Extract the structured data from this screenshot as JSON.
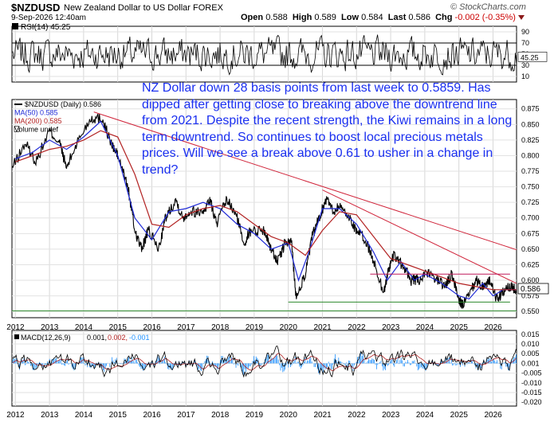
{
  "header": {
    "symbol": "$NZDUSD",
    "name": "New Zealand Dollar to US Dollar",
    "exchange": "FOREX",
    "date": "9-Sep-2026 12:40am",
    "open_label": "Open",
    "open": "0.588",
    "high_label": "High",
    "high": "0.589",
    "low_label": "Low",
    "low": "0.584",
    "last_label": "Last",
    "last": "0.586",
    "chg_label": "Chg",
    "chg": "-0.002 (-0.35%)",
    "copyright": "© StockCharts.com"
  },
  "annotation": "NZ Dollar down 28 basis points from last week to 0.5859. Has dipped after getting close to breaking above the downtrend line from 2021. Despite the recent strength, the Kiwi remains in a long term downtrend. So continues to boost local precious metals prices. Will we see a break above 0.61 to usher in a change in trend?",
  "chart_data": [
    {
      "type": "line",
      "panel": "rsi",
      "legend": "RSI(14) 45.25",
      "last_value": 45.25,
      "ylim": [
        0,
        100
      ],
      "yticks": [
        10,
        30,
        50,
        70,
        90
      ],
      "yticklabels": [
        "10",
        "30",
        "50",
        "70",
        "90"
      ],
      "reference_lines": [
        30,
        70
      ],
      "colors": {
        "line": "#000000",
        "fill_over": "#b22222",
        "fill_under": "#1e90ff"
      }
    },
    {
      "type": "line",
      "panel": "price",
      "legend": [
        {
          "label": "$NZDUSD (Daily) 0.586",
          "color": "#000000"
        },
        {
          "label": "MA(50) 0.585",
          "color": "#1f2ad6"
        },
        {
          "label": "MA(200) 0.585",
          "color": "#b22222"
        },
        {
          "label": "Volume undef",
          "color": "#000000"
        }
      ],
      "x_ticklabels": [
        "2012",
        "2013",
        "2014",
        "2015",
        "2016",
        "2017",
        "2018",
        "2019",
        "2020",
        "2021",
        "2022",
        "2023",
        "2024",
        "2025",
        "2026"
      ],
      "ylim": [
        0.54,
        0.89
      ],
      "yticks": [
        0.55,
        0.575,
        0.6,
        0.625,
        0.65,
        0.675,
        0.7,
        0.725,
        0.75,
        0.775,
        0.8,
        0.825,
        0.85,
        0.875
      ],
      "yticklabels": [
        "0.550",
        "0.575",
        "0.600",
        "0.625",
        "0.650",
        "0.675",
        "0.700",
        "0.725",
        "0.750",
        "0.775",
        "0.800",
        "0.825",
        "0.850",
        "0.875"
      ],
      "last_value": 0.586,
      "series": [
        {
          "name": "$NZDUSD",
          "color": "#000000",
          "x": [
            2011.9,
            2012.3,
            2012.6,
            2013.0,
            2013.3,
            2013.5,
            2013.8,
            2014.2,
            2014.55,
            2014.8,
            2015.0,
            2015.3,
            2015.5,
            2015.7,
            2015.9,
            2016.2,
            2016.4,
            2016.7,
            2016.9,
            2017.1,
            2017.5,
            2017.7,
            2017.9,
            2018.2,
            2018.5,
            2018.7,
            2018.9,
            2019.3,
            2019.5,
            2019.7,
            2019.9,
            2020.1,
            2020.22,
            2020.5,
            2020.7,
            2020.9,
            2021.15,
            2021.3,
            2021.5,
            2021.8,
            2022.0,
            2022.3,
            2022.5,
            2022.8,
            2022.95,
            2023.1,
            2023.4,
            2023.6,
            2023.8,
            2024.1,
            2024.4,
            2024.6,
            2024.8,
            2025.0,
            2025.1,
            2025.3,
            2025.5,
            2025.7,
            2025.9,
            2026.1,
            2026.3,
            2026.5,
            2026.69
          ],
          "y": [
            0.78,
            0.82,
            0.79,
            0.84,
            0.82,
            0.78,
            0.82,
            0.86,
            0.86,
            0.82,
            0.8,
            0.75,
            0.68,
            0.65,
            0.68,
            0.65,
            0.7,
            0.73,
            0.7,
            0.71,
            0.71,
            0.73,
            0.69,
            0.73,
            0.7,
            0.66,
            0.68,
            0.68,
            0.65,
            0.63,
            0.66,
            0.66,
            0.575,
            0.61,
            0.67,
            0.7,
            0.735,
            0.71,
            0.72,
            0.7,
            0.68,
            0.66,
            0.63,
            0.58,
            0.62,
            0.64,
            0.62,
            0.6,
            0.6,
            0.61,
            0.6,
            0.59,
            0.61,
            0.57,
            0.56,
            0.575,
            0.6,
            0.59,
            0.6,
            0.57,
            0.58,
            0.59,
            0.586
          ]
        },
        {
          "name": "MA(50)",
          "color": "#1f2ad6",
          "x": [
            2012.0,
            2012.5,
            2013.0,
            2013.5,
            2014.0,
            2014.5,
            2015.0,
            2015.5,
            2016.0,
            2016.5,
            2017.0,
            2017.5,
            2018.0,
            2018.5,
            2019.0,
            2019.5,
            2020.0,
            2020.3,
            2020.6,
            2021.0,
            2021.5,
            2022.0,
            2022.5,
            2022.9,
            2023.3,
            2023.7,
            2024.0,
            2024.5,
            2025.0,
            2025.3,
            2025.7,
            2026.0,
            2026.3,
            2026.69
          ],
          "y": [
            0.795,
            0.805,
            0.825,
            0.81,
            0.83,
            0.855,
            0.8,
            0.7,
            0.665,
            0.71,
            0.715,
            0.725,
            0.715,
            0.69,
            0.675,
            0.65,
            0.66,
            0.6,
            0.645,
            0.715,
            0.715,
            0.69,
            0.645,
            0.6,
            0.63,
            0.6,
            0.61,
            0.595,
            0.575,
            0.57,
            0.595,
            0.575,
            0.585,
            0.585
          ]
        },
        {
          "name": "MA(200)",
          "color": "#b22222",
          "x": [
            2012.0,
            2012.5,
            2013.0,
            2013.5,
            2014.0,
            2014.5,
            2015.0,
            2015.5,
            2016.0,
            2016.5,
            2017.0,
            2017.5,
            2018.0,
            2018.5,
            2019.0,
            2019.5,
            2020.0,
            2020.5,
            2021.0,
            2021.5,
            2022.0,
            2022.5,
            2023.0,
            2023.5,
            2024.0,
            2024.5,
            2025.0,
            2025.5,
            2026.0,
            2026.69
          ],
          "y": [
            0.79,
            0.8,
            0.81,
            0.815,
            0.825,
            0.84,
            0.83,
            0.77,
            0.69,
            0.685,
            0.705,
            0.715,
            0.72,
            0.71,
            0.69,
            0.67,
            0.66,
            0.64,
            0.68,
            0.71,
            0.705,
            0.67,
            0.635,
            0.625,
            0.615,
            0.605,
            0.595,
            0.59,
            0.585,
            0.585
          ]
        }
      ],
      "annotations": {
        "trendlines": [
          {
            "x": [
              2014.3,
              2026.69
            ],
            "y": [
              0.87,
              0.649
            ]
          },
          {
            "x": [
              2021.0,
              2026.69
            ],
            "y": [
              0.745,
              0.595
            ]
          }
        ],
        "hlines": [
          {
            "x": [
              2020.0,
              2026.5
            ],
            "y": 0.565
          },
          {
            "x": [
              2011.9,
              2026.69
            ],
            "y": 0.551
          },
          {
            "x": [
              2022.4,
              2026.5
            ],
            "y": 0.61
          }
        ]
      }
    },
    {
      "type": "line",
      "panel": "macd",
      "legend": {
        "label": "MACD(12,26,9)",
        "macd": "0.001",
        "signal": "0.002",
        "hist": "-0.001"
      },
      "ylim": [
        -0.022,
        0.017
      ],
      "yticks": [
        0.015,
        0.01,
        0.005,
        0.0,
        -0.005,
        -0.01,
        -0.015,
        -0.02
      ],
      "yticklabels": [
        "0.015",
        "0.010",
        "0.005",
        "0.001",
        "-0.005",
        "-0.010",
        "-0.015",
        "-0.020"
      ],
      "x_ticklabels": [
        "2012",
        "2013",
        "2014",
        "2015",
        "2016",
        "2017",
        "2018",
        "2019",
        "2020",
        "2021",
        "2022",
        "2023",
        "2024",
        "2025",
        "2026"
      ],
      "colors": {
        "macd": "#000000",
        "signal": "#b22222",
        "histogram": "#1e90ff"
      }
    }
  ]
}
